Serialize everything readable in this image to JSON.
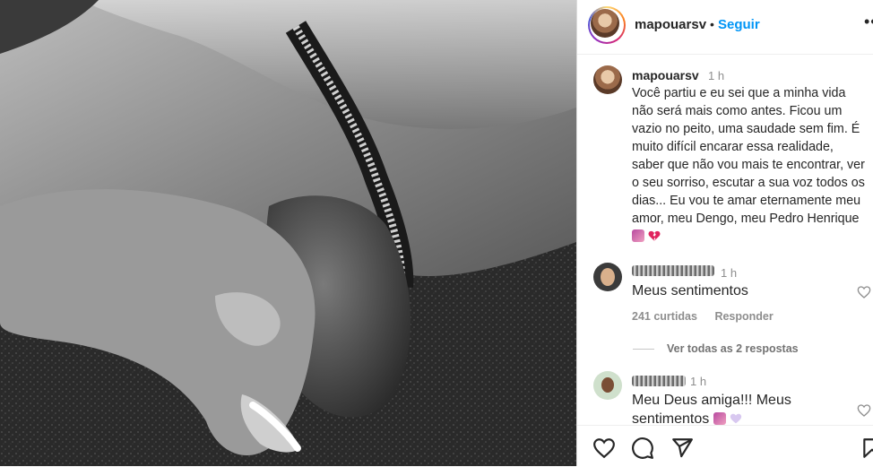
{
  "header": {
    "username": "mapouarsv",
    "separator": "•",
    "follow_label": "Seguir",
    "more_icon": "more-horizontal-icon"
  },
  "caption": {
    "username": "mapouarsv",
    "time": "1 h",
    "text": "Você partiu e eu sei que a minha vida não será mais como antes. Ficou um vazio no peito, uma saudade sem fim. É muito difícil encarar essa realidade, saber que não vou mais te encontrar, ver o seu sorriso, escutar a sua voz todos os dias... Eu vou te amar eternamente meu amor, meu Dengo, meu Pedro Henrique",
    "emojis": [
      "camera-emoji",
      "broken-heart-emoji"
    ]
  },
  "comments": [
    {
      "username_hidden": true,
      "time": "1 h",
      "text": "Meus sentimentos",
      "likes": "241 curtidas",
      "reply_label": "Responder",
      "view_replies": "Ver todas as 2 respostas"
    },
    {
      "username_hidden": true,
      "time": "1 h",
      "text_line1": "Meu Deus amiga!!! Meus",
      "text_line2": "sentimentos",
      "emojis": [
        "camera-emoji",
        "heart-emoji"
      ]
    }
  ],
  "actions": [
    "like-icon",
    "comment-icon",
    "share-icon",
    "save-icon"
  ],
  "colors": {
    "link": "#0095f6",
    "text": "#262626",
    "secondary": "#8e8e8e",
    "divider": "#efefef"
  }
}
